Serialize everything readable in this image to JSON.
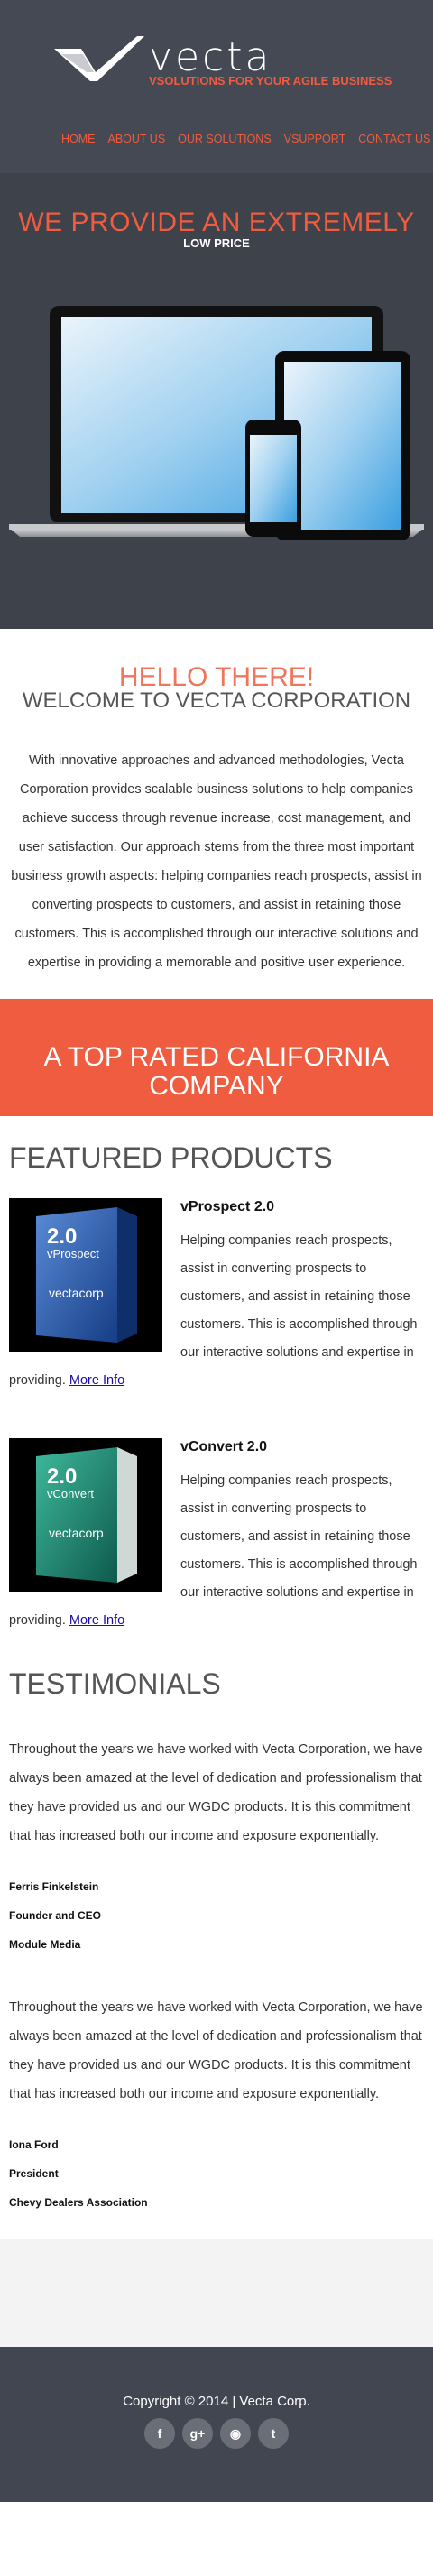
{
  "header": {
    "brand": "vecta",
    "tagline": "VSOLUTIONS FOR YOUR AGILE BUSINESS",
    "nav": [
      "HOME",
      "ABOUT US",
      "OUR SOLUTIONS",
      "VSUPPORT",
      "CONTACT US"
    ]
  },
  "hero": {
    "title": "WE PROVIDE AN EXTREMELY",
    "subtitle": "LOW PRICE"
  },
  "welcome": {
    "hello": "HELLO THERE!",
    "title": "WELCOME TO VECTA CORPORATION",
    "text": "With innovative approaches and advanced methodologies, Vecta Corporation provides scalable business solutions to help companies achieve success through revenue increase, cost management, and user satisfaction. Our approach stems from the three most important business growth aspects: helping companies reach prospects, assist in converting prospects to customers, and assist in retaining those customers. This is accomplished through our interactive solutions and expertise in providing a memorable and positive user experience."
  },
  "banner": {
    "text": "A TOP RATED CALIFORNIA COMPANY"
  },
  "featured": {
    "title": "FEATURED PRODUCTS",
    "products": [
      {
        "box_version": "2.0",
        "box_name": "vProspect",
        "box_brand": "vectacorp",
        "name": "vProspect 2.0",
        "desc": "Helping companies reach prospects, assist in converting prospects to customers, and assist in retaining those customers. This is accomplished through our interactive solutions and expertise in providing.",
        "link": "More Info"
      },
      {
        "box_version": "2.0",
        "box_name": "vConvert",
        "box_brand": "vectacorp",
        "name": "vConvert 2.0",
        "desc": "Helping companies reach prospects, assist in converting prospects to customers, and assist in retaining those customers. This is accomplished through our interactive solutions and expertise in providing.",
        "link": "More Info"
      }
    ]
  },
  "testimonials": {
    "title": "TESTIMONIALS",
    "items": [
      {
        "text": "Throughout the years we have worked with Vecta Corporation, we have always been amazed at the level of dedication and professionalism that they have provided us and our WGDC products. It is this commitment that has increased both our income and exposure exponentially.",
        "name": "Ferris Finkelstein",
        "role": "Founder and CEO",
        "company": "Module Media"
      },
      {
        "text": "Throughout the years we have worked with Vecta Corporation, we have always been amazed at the level of dedication and professionalism that they have provided us and our WGDC products. It is this commitment that has increased both our income and exposure exponentially.",
        "name": "Iona Ford",
        "role": "President",
        "company": "Chevy Dealers Association"
      }
    ]
  },
  "footer": {
    "copyright": "Copyright © 2014 | Vecta Corp.",
    "social": [
      {
        "icon": "facebook-icon",
        "glyph": "f"
      },
      {
        "icon": "google-plus-icon",
        "glyph": "g+"
      },
      {
        "icon": "rss-icon",
        "glyph": "◉"
      },
      {
        "icon": "twitter-icon",
        "glyph": "t"
      }
    ]
  },
  "colors": {
    "accent": "#ef5c3f",
    "header_bg": "#444953",
    "hero_bg": "#3e424a",
    "footer_bg": "#414650"
  }
}
